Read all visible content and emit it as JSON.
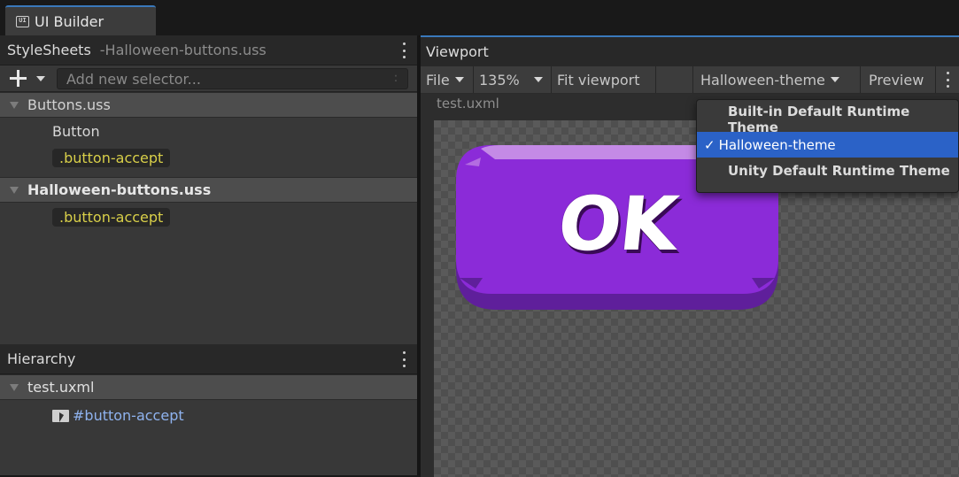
{
  "window": {
    "tab_icon_text": "UI",
    "tab_title": "UI Builder"
  },
  "stylesheets": {
    "header": "StyleSheets",
    "active_file": "-Halloween-buttons.uss",
    "selector_placeholder": "Add new selector...",
    "selector_colon": ":",
    "tree": [
      {
        "type": "file",
        "label": "Buttons.uss",
        "bold": false
      },
      {
        "type": "selector",
        "label": "Button",
        "style": "type"
      },
      {
        "type": "selector",
        "label": ".button-accept",
        "style": "class"
      },
      {
        "type": "file",
        "label": "Halloween-buttons.uss",
        "bold": true
      },
      {
        "type": "selector",
        "label": ".button-accept",
        "style": "class"
      }
    ]
  },
  "hierarchy": {
    "header": "Hierarchy",
    "root": "test.uxml",
    "item": "#button-accept"
  },
  "viewport": {
    "header": "Viewport",
    "toolbar": {
      "file": "File",
      "zoom": "135%",
      "fit": "Fit viewport",
      "theme": "Halloween-theme",
      "preview": "Preview"
    },
    "document_label": "test.uxml",
    "canvas_button_text": "OK"
  },
  "theme_menu": {
    "items": [
      {
        "label": "Built-in Default Runtime Theme",
        "selected": false
      },
      {
        "label": "Halloween-theme",
        "selected": true
      },
      {
        "label": "Unity Default Runtime Theme",
        "selected": false
      }
    ],
    "check_glyph": "✓"
  },
  "colors": {
    "accent_blue": "#3a79bb",
    "menu_selected": "#2b62c7",
    "selector_class_text": "#d8cf49",
    "hierarchy_item_text": "#8fb3ef",
    "button_purple": "#8b2bd8",
    "button_purple_dark": "#5f1f9b",
    "button_highlight": "#c48ae6"
  }
}
